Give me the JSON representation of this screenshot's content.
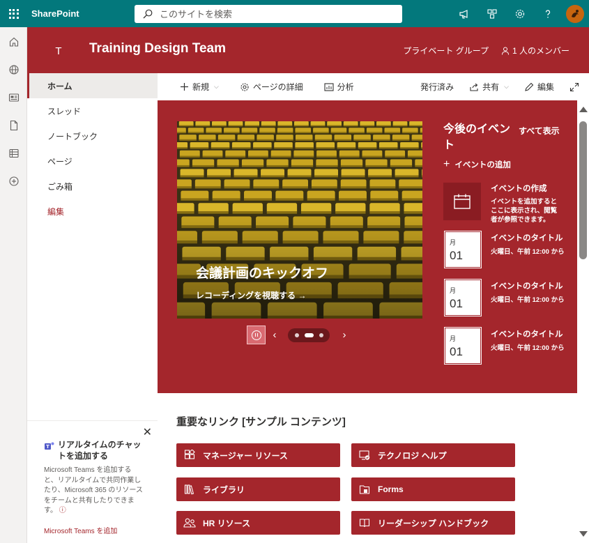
{
  "suite": {
    "brand": "SharePoint",
    "search_placeholder": "このサイトを検索"
  },
  "site": {
    "logo_letter": "T",
    "title": "Training Design Team",
    "privacy": "プライベート グループ",
    "members": "1 人のメンバー"
  },
  "nav": {
    "items": [
      "ホーム",
      "スレッド",
      "ノートブック",
      "ページ",
      "ごみ箱",
      "編集"
    ]
  },
  "commands": {
    "new": "新規",
    "page_details": "ページの詳細",
    "analytics": "分析",
    "published": "発行済み",
    "share": "共有",
    "edit": "編集"
  },
  "hero": {
    "title": "会議計画のキックオフ",
    "link": "レコーディングを視聴する →"
  },
  "events": {
    "title": "今後のイベント",
    "see_all": "すべて表示",
    "add": "イベントの追加",
    "create_title": "イベントの作成",
    "create_desc": "イベントを追加するとここに表示され、閲覧者が参照できます。",
    "items": [
      {
        "month": "月",
        "day": "01",
        "title": "イベントのタイトル",
        "time": "火曜日、午前 12:00 から"
      },
      {
        "month": "月",
        "day": "01",
        "title": "イベントのタイトル",
        "time": "火曜日、午前 12:00 から"
      },
      {
        "month": "月",
        "day": "01",
        "title": "イベントのタイトル",
        "time": "火曜日、午前 12:00 から"
      }
    ]
  },
  "links": {
    "title": "重要なリンク [サンプル コンテンツ]",
    "items": [
      "マネージャー リソース",
      "テクノロジ ヘルプ",
      "ライブラリ",
      "Forms",
      "HR リソース",
      "リーダーシップ ハンドブック"
    ]
  },
  "teams": {
    "title": "リアルタイムのチャットを追加する",
    "body": "Microsoft Teams を追加すると、リアルタイムで共同作業したり、Microsoft 365 のリソースをチームと共有したりできます。",
    "link": "Microsoft Teams を追加"
  },
  "colors": {
    "suitebar": "#03787c",
    "theme": "#a4262c"
  }
}
